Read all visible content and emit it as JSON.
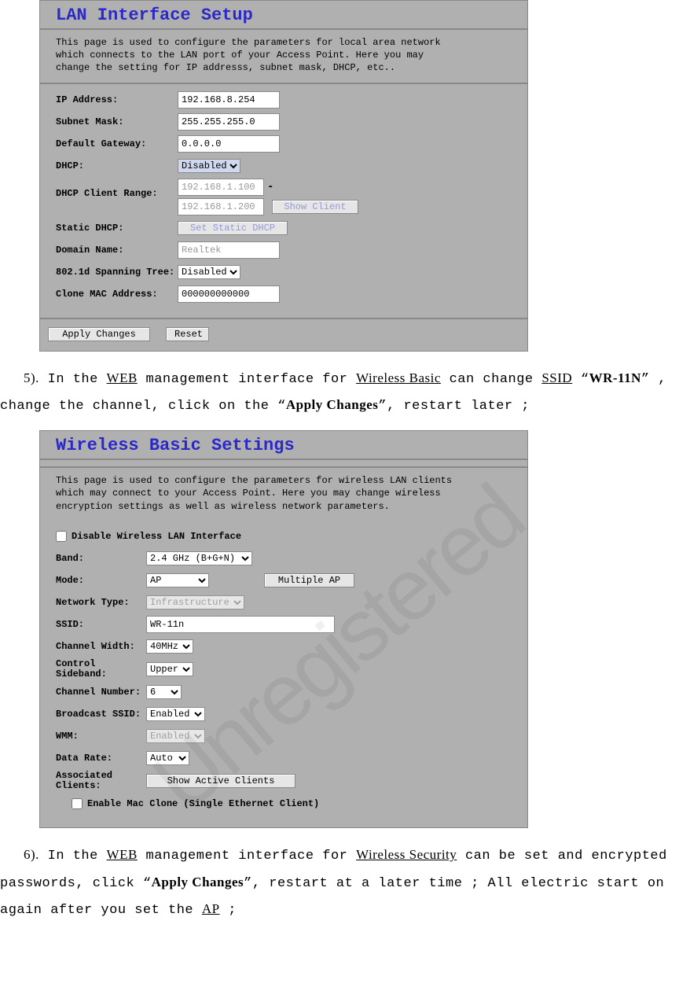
{
  "lan": {
    "title": "LAN Interface Setup",
    "desc": "This page is used to configure the parameters for local area network which connects to the LAN port of your Access Point. Here you may change the setting for IP addresss, subnet mask, DHCP, etc..",
    "labels": {
      "ip": "IP Address:",
      "mask": "Subnet Mask:",
      "gw": "Default Gateway:",
      "dhcp": "DHCP:",
      "range": "DHCP Client Range:",
      "sdhcp": "Static DHCP:",
      "domain": "Domain Name:",
      "stp": "802.1d Spanning Tree:",
      "clone": "Clone MAC Address:"
    },
    "values": {
      "ip": "192.168.8.254",
      "mask": "255.255.255.0",
      "gw": "0.0.0.0",
      "dhcp": "Disabled",
      "range_from": "192.168.1.100",
      "range_to": "192.168.1.200",
      "domain": "Realtek",
      "stp": "Disabled",
      "clone": "000000000000"
    },
    "buttons": {
      "show_client": "Show Client",
      "set_static": "Set Static DHCP",
      "apply": "Apply Changes",
      "reset": "Reset"
    }
  },
  "step5": {
    "prefix": "5).",
    "t1": "In the ",
    "u1": "WEB",
    "t2": " management interface for ",
    "u2": "Wireless Basic",
    "t3": " can change ",
    "u3": "SSID",
    "q1": " “",
    "b1": "WR-11N",
    "q2": "” ,",
    "t4": "change the channel, click on the “",
    "b2": "Apply Changes",
    "t5": "”, restart later ;"
  },
  "wlan": {
    "title": "Wireless Basic Settings",
    "desc": "This page is used to configure the parameters for wireless LAN clients which may connect to your Access Point. Here you may change wireless encryption settings as well as wireless network parameters.",
    "cb_disable": "Disable Wireless LAN Interface",
    "labels": {
      "band": "Band:",
      "mode": "Mode:",
      "ntype": "Network Type:",
      "ssid": "SSID:",
      "cw": "Channel Width:",
      "csb": "Control Sideband:",
      "cnum": "Channel Number:",
      "bssid": "Broadcast SSID:",
      "wmm": "WMM:",
      "rate": "Data Rate:",
      "assoc": "Associated Clients:"
    },
    "values": {
      "band": "2.4 GHz (B+G+N)",
      "mode": "AP",
      "ntype": "Infrastructure",
      "ssid": "WR-11n",
      "cw": "40MHz",
      "csb": "Upper",
      "cnum": "6",
      "bssid": "Enabled",
      "wmm": "Enabled",
      "rate": "Auto"
    },
    "buttons": {
      "multi_ap": "Multiple AP",
      "show_active": "Show Active Clients"
    },
    "cb_macclone": "Enable Mac Clone (Single Ethernet Client)"
  },
  "step6": {
    "prefix": "6).",
    "t1": "In the ",
    "u1": "WEB",
    "t2": " management interface for ",
    "u2": "Wireless Security",
    "t3": " can be set and encrypted",
    "t4": "passwords, click “",
    "b1": "Apply Changes",
    "t5": "”, restart at a later time ; All electric start on",
    "t6": "again after you set the ",
    "u3": "AP",
    "t7": " ;"
  }
}
